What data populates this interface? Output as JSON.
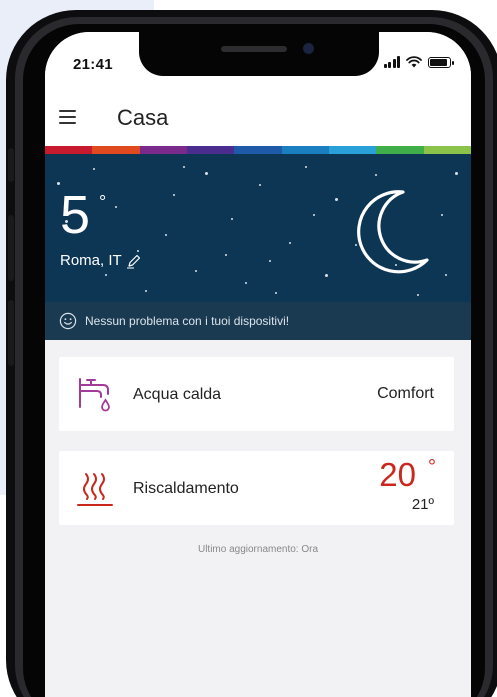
{
  "status_bar": {
    "time": "21:41",
    "battery_level": 0.9,
    "signal_bars": 4
  },
  "header": {
    "title": "Casa",
    "menu_icon": "hamburger-menu-icon"
  },
  "rainbow_colors": [
    "#c81a2e",
    "#e14a1f",
    "#7a2a8a",
    "#4b2d8f",
    "#1e5aa8",
    "#1a7fc1",
    "#2aa0d8",
    "#3fae49",
    "#8bc34a"
  ],
  "weather": {
    "temperature": "5",
    "degree_symbol": "°",
    "location": "Roma, IT",
    "edit_icon": "pencil-icon",
    "condition_icon": "crescent-moon-icon",
    "background_color": "#0d3554"
  },
  "notice": {
    "icon": "smiley-icon",
    "text": "Nessun problema con i tuoi dispositivi!"
  },
  "devices": [
    {
      "icon": "faucet-icon",
      "label": "Acqua calda",
      "value": "Comfort"
    },
    {
      "icon": "heat-waves-icon",
      "label": "Riscaldamento",
      "current_temp": "20",
      "degree_symbol": "°",
      "target_temp": "21º",
      "accent_color": "#c8281e"
    }
  ],
  "footer": {
    "last_update": "Ultimo aggiornamento: Ora"
  }
}
